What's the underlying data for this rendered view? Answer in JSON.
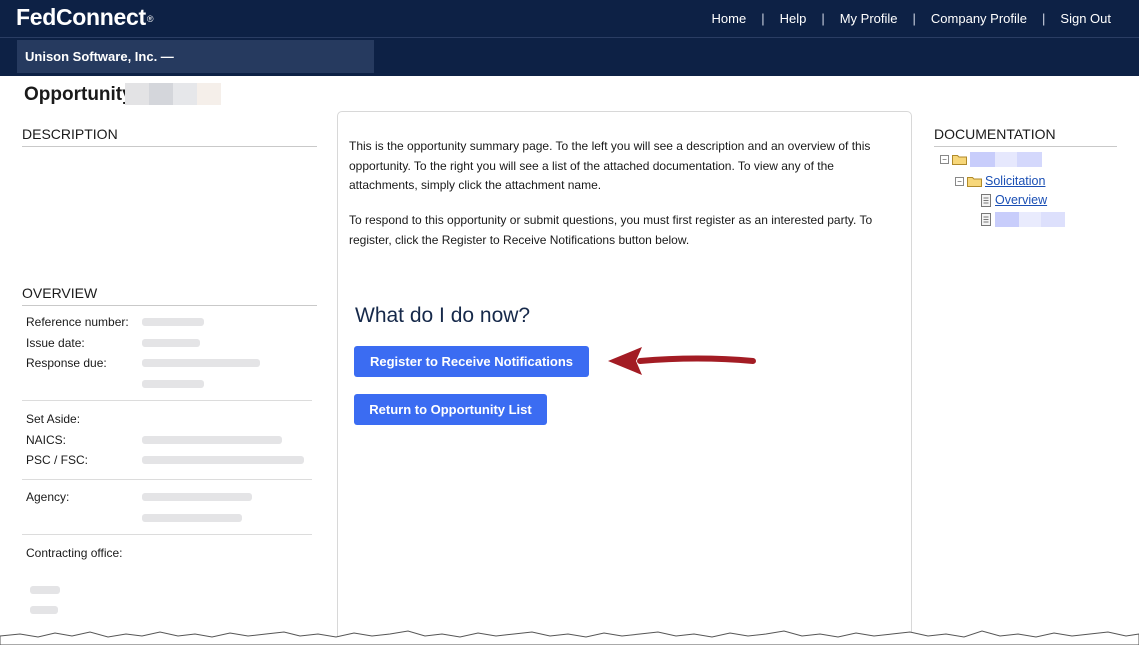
{
  "header": {
    "logo": "FedConnect",
    "logo_mark": "®",
    "nav": [
      {
        "label": "Home"
      },
      {
        "label": "Help"
      },
      {
        "label": "My Profile"
      },
      {
        "label": "Company Profile"
      },
      {
        "label": "Sign Out"
      }
    ],
    "separator": "|"
  },
  "company_bar": {
    "name": "Unison Software, Inc. —"
  },
  "opportunity": {
    "title_label": "Opportunity:"
  },
  "description": {
    "heading": "DESCRIPTION"
  },
  "overview": {
    "heading": "OVERVIEW",
    "fields": {
      "reference_number": "Reference number:",
      "issue_date": "Issue date:",
      "response_due": "Response due:",
      "set_aside": "Set Aside:",
      "naics": "NAICS:",
      "psc_fsc": "PSC / FSC:",
      "agency": "Agency:",
      "contracting_office": "Contracting office:"
    }
  },
  "summary": {
    "paragraph_1": "This is the opportunity summary page. To the left you will see a description and an overview of this opportunity. To the right you will see a list of the attached documentation. To view any of the attachments, simply click the attachment name.",
    "paragraph_2": "To respond to this opportunity or submit questions, you must first register as an interested party. To register, click the Register to Receive Notifications button below.",
    "heading": "What do I do now?",
    "register_button": "Register to Receive Notifications",
    "return_button": "Return to Opportunity List"
  },
  "documentation": {
    "heading": "DOCUMENTATION",
    "solicitation_label": "Solicitation",
    "overview_link": "Overview"
  },
  "colors": {
    "header_bg": "#0d2145",
    "button_bg": "#3b6cf2",
    "arrow": "#a31c24",
    "link": "#1a4fb4"
  },
  "icons": [
    "folder-icon",
    "document-icon",
    "collapse-icon",
    "arrow-annotation-icon"
  ]
}
